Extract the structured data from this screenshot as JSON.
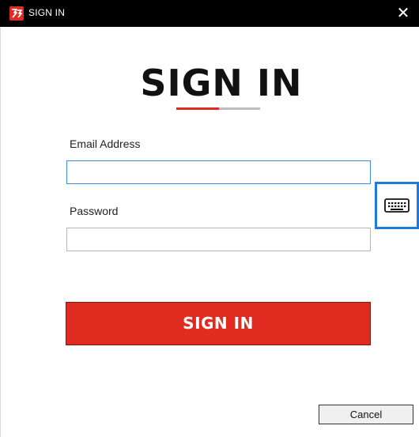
{
  "window": {
    "title": "SIGN IN",
    "close_glyph": "✕",
    "logo_icon": "app-logo-icon"
  },
  "form": {
    "heading": "SIGN IN",
    "email": {
      "label": "Email Address",
      "value": "",
      "placeholder": ""
    },
    "password": {
      "label": "Password",
      "value": "",
      "placeholder": ""
    },
    "submit_label": "SIGN IN",
    "cancel_label": "Cancel",
    "keyboard_icon": "keyboard-icon"
  },
  "colors": {
    "accent": "#e02b20",
    "focus": "#1f7ae0",
    "titlebar": "#000000",
    "underline_secondary": "#bdbdbd"
  }
}
